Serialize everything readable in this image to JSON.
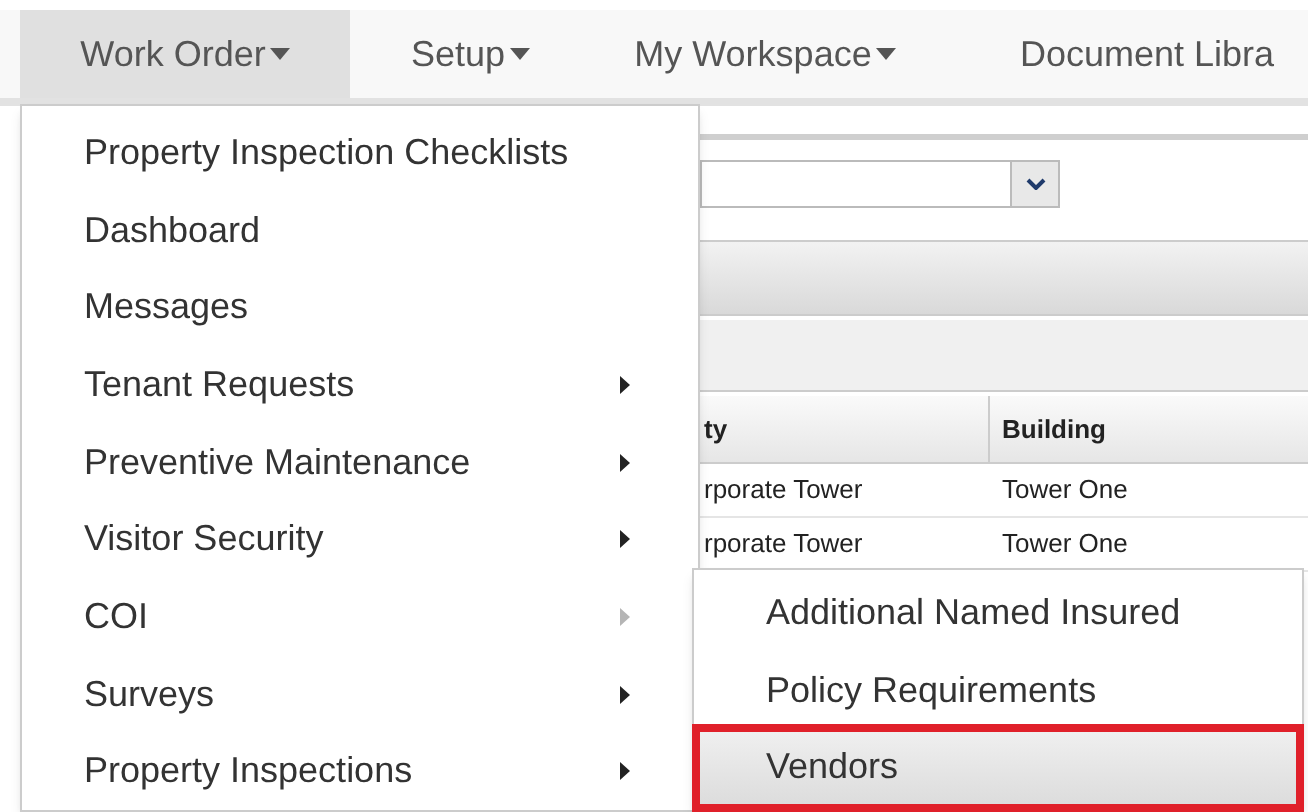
{
  "nav": [
    {
      "label": "Work Order",
      "caret": true,
      "selected": true
    },
    {
      "label": "Setup",
      "caret": true,
      "selected": false
    },
    {
      "label": "My Workspace",
      "caret": true,
      "selected": false
    },
    {
      "label": "Document Libra",
      "caret": false,
      "selected": false
    }
  ],
  "filter": {
    "kind": "select"
  },
  "table": {
    "columns": [
      "ty",
      "Building"
    ],
    "rows": [
      [
        "rporate Tower",
        "Tower One"
      ],
      [
        "rporate Tower",
        "Tower One"
      ]
    ]
  },
  "menu": {
    "items": [
      {
        "label": "Property Inspection Checklists",
        "has_submenu": false,
        "expanded": false
      },
      {
        "label": "Dashboard",
        "has_submenu": false,
        "expanded": false
      },
      {
        "label": "Messages",
        "has_submenu": false,
        "expanded": false
      },
      {
        "label": "Tenant Requests",
        "has_submenu": true,
        "expanded": false
      },
      {
        "label": "Preventive Maintenance",
        "has_submenu": true,
        "expanded": false
      },
      {
        "label": "Visitor Security",
        "has_submenu": true,
        "expanded": false
      },
      {
        "label": "COI",
        "has_submenu": true,
        "expanded": true
      },
      {
        "label": "Surveys",
        "has_submenu": true,
        "expanded": false
      },
      {
        "label": "Property Inspections",
        "has_submenu": true,
        "expanded": false
      }
    ]
  },
  "submenu": {
    "items": [
      {
        "label": "Additional Named Insured",
        "selected": false,
        "annotated": false
      },
      {
        "label": "Policy Requirements",
        "selected": false,
        "annotated": false
      },
      {
        "label": "Vendors",
        "selected": true,
        "annotated": true
      }
    ]
  }
}
